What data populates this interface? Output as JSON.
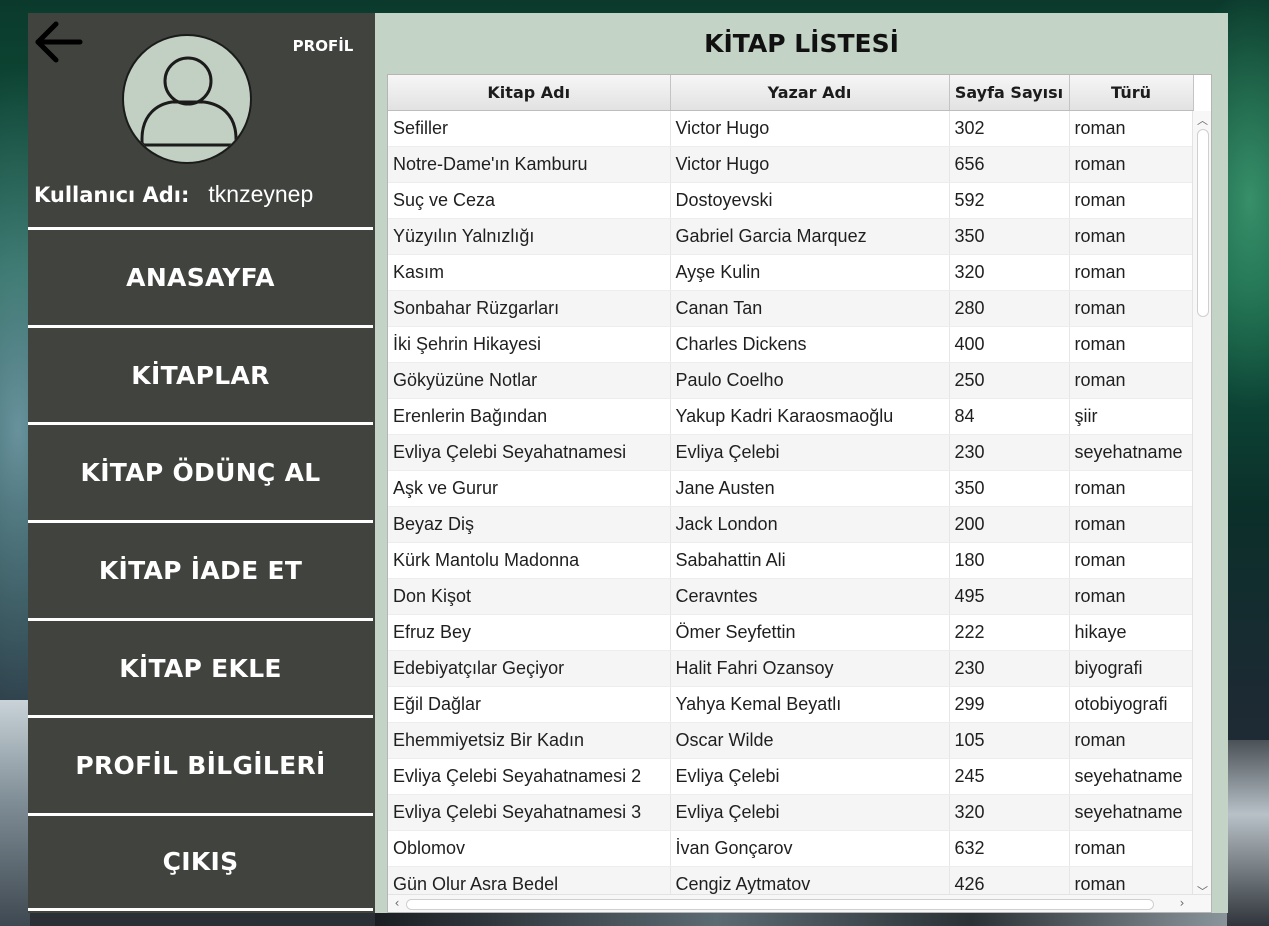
{
  "sidebar": {
    "profile_label": "PROFİL",
    "username_label": "Kullanıcı Adı:",
    "username_value": "tknzeynep",
    "menu": [
      {
        "label": "ANASAYFA"
      },
      {
        "label": "KİTAPLAR"
      },
      {
        "label": "KİTAP ÖDÜNÇ AL"
      },
      {
        "label": "KİTAP İADE ET"
      },
      {
        "label": "KİTAP EKLE"
      },
      {
        "label": "PROFİL BİLGİLERİ"
      },
      {
        "label": "ÇIKIŞ"
      }
    ]
  },
  "main": {
    "title": "KİTAP LİSTESİ",
    "columns": [
      "Kitap Adı",
      "Yazar Adı",
      "Sayfa Sayısı",
      "Türü"
    ],
    "rows": [
      [
        "Sefiller",
        "Victor Hugo",
        "302",
        "roman"
      ],
      [
        "Notre-Dame'ın Kamburu",
        "Victor Hugo",
        "656",
        "roman"
      ],
      [
        "Suç ve Ceza",
        "Dostoyevski",
        "592",
        "roman"
      ],
      [
        "Yüzyılın Yalnızlığı",
        "Gabriel Garcia Marquez",
        "350",
        "roman"
      ],
      [
        "Kasım",
        "Ayşe Kulin",
        "320",
        "roman"
      ],
      [
        "Sonbahar Rüzgarları",
        "Canan Tan",
        "280",
        "roman"
      ],
      [
        "İki Şehrin Hikayesi",
        "Charles Dickens",
        "400",
        "roman"
      ],
      [
        "Gökyüzüne Notlar",
        "Paulo Coelho",
        "250",
        "roman"
      ],
      [
        "Erenlerin Bağından",
        "Yakup Kadri Karaosmaoğlu",
        "84",
        "şiir"
      ],
      [
        "Evliya Çelebi Seyahatnamesi",
        "Evliya Çelebi",
        "230",
        "seyehatname"
      ],
      [
        "Aşk ve Gurur",
        "Jane Austen",
        "350",
        "roman"
      ],
      [
        "Beyaz Diş",
        "Jack London",
        "200",
        "roman"
      ],
      [
        "Kürk Mantolu Madonna",
        "Sabahattin Ali",
        "180",
        "roman"
      ],
      [
        "Don Kişot",
        "Ceravntes",
        "495",
        "roman"
      ],
      [
        "Efruz Bey",
        "Ömer Seyfettin",
        "222",
        "hikaye"
      ],
      [
        "Edebiyatçılar Geçiyor",
        "Halit Fahri Ozansoy",
        "230",
        "biyografi"
      ],
      [
        "Eğil Dağlar",
        "Yahya Kemal Beyatlı",
        "299",
        "otobiyografi"
      ],
      [
        "Ehemmiyetsiz Bir Kadın",
        "Oscar Wilde",
        "105",
        "roman"
      ],
      [
        "Evliya Çelebi Seyahatnamesi 2",
        "Evliya Çelebi",
        "245",
        "seyehatname"
      ],
      [
        "Evliya Çelebi Seyahatnamesi 3",
        "Evliya Çelebi",
        "320",
        "seyehatname"
      ],
      [
        "Oblomov",
        "İvan Gonçarov",
        "632",
        "roman"
      ],
      [
        "Gün Olur Asra Bedel",
        "Cengiz Aytmatov",
        "426",
        "roman"
      ]
    ]
  },
  "colors": {
    "sidebar_bg": "#40433e",
    "panel_bg": "#c3d3c5",
    "avatar_bg": "#c2cfc3"
  },
  "icons": {
    "back": "arrow-left-icon",
    "avatar": "user-silhouette-icon"
  }
}
